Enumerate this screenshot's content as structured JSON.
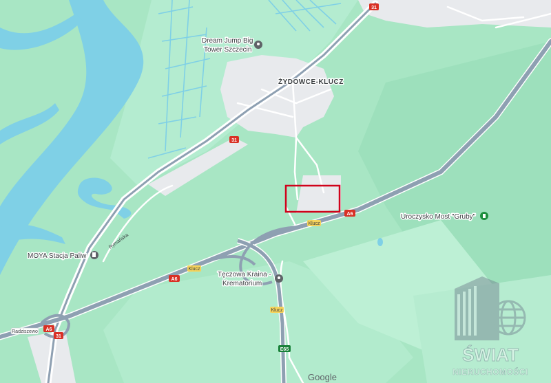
{
  "map": {
    "places": {
      "district": "ŻYDOWCE-KLUCZ",
      "poi_trampoline_line1": "Dream Jump Big",
      "poi_trampoline_line2": "Tower Szczecin",
      "poi_fuel": "MOYA Stacja Paliw",
      "poi_reserve": "Uroczysko Most \"Gruby\"",
      "poi_crematorium_line1": "Tęczowa Kraina -",
      "poi_crematorium_line2": "Krematorium"
    },
    "roads": {
      "ryman": "Rymańska",
      "klucz_1": "Klucz",
      "klucz_2": "Klucz",
      "klucz_3": "Klucz",
      "radziszewo": "Radziszewo"
    },
    "shields": {
      "r31_top": "31",
      "r31_mid": "31",
      "r31_bottom": "31",
      "a6_right": "A6",
      "a6_mid": "A6",
      "a6_left": "A6",
      "e65": "E65"
    },
    "highlight_color": "#d0021b",
    "water_color": "#7fd0e6",
    "green_color": "#a8e6c4",
    "highway_color": "#8ea0b2"
  },
  "attribution": "Google",
  "watermark": {
    "line1": "ŚWIAT",
    "line2": "NIERUCHOMOŚCI"
  }
}
